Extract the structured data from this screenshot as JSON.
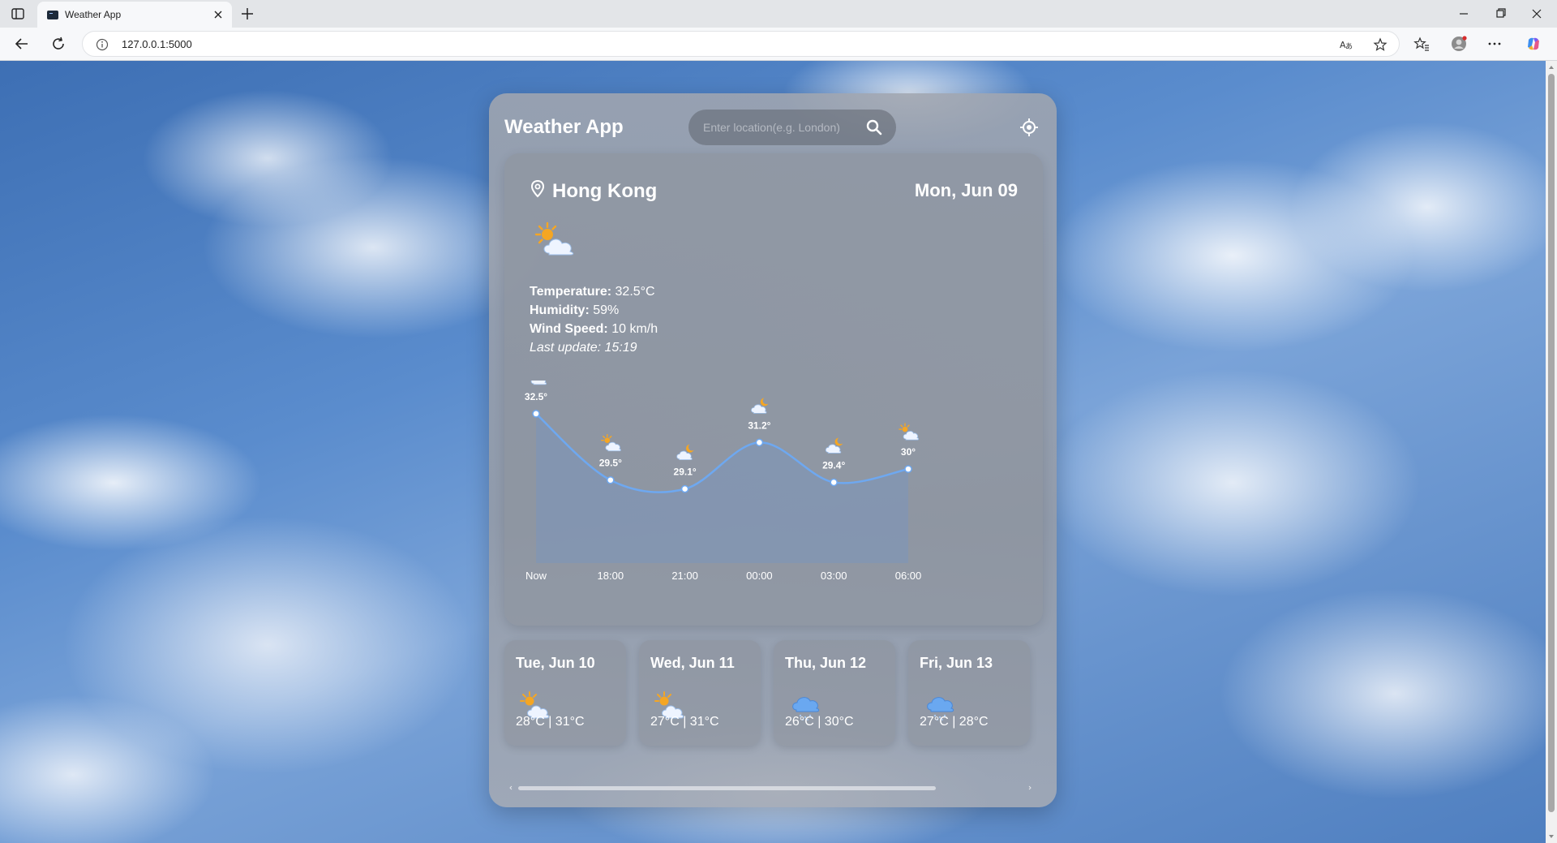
{
  "browser": {
    "tab_title": "Weather App",
    "url": "127.0.0.1:5000"
  },
  "app": {
    "title": "Weather App",
    "search_placeholder": "Enter location(e.g. London)",
    "location": "Hong Kong",
    "date": "Mon, Jun 09",
    "current_icon": "partly-cloudy-day-icon",
    "details": {
      "temperature_label": "Temperature:",
      "temperature_value": "32.5°C",
      "humidity_label": "Humidity:",
      "humidity_value": "59%",
      "wind_label": "Wind Speed:",
      "wind_value": "10 km/h",
      "last_update": "Last update: 15:19"
    },
    "forecast": [
      {
        "date": "Tue, Jun 10",
        "icon": "partly-cloudy-day-icon",
        "temps": "28°C | 31°C"
      },
      {
        "date": "Wed, Jun 11",
        "icon": "partly-cloudy-day-icon",
        "temps": "27°C | 31°C"
      },
      {
        "date": "Thu, Jun 12",
        "icon": "rain-cloud-icon",
        "temps": "26°C | 30°C"
      },
      {
        "date": "Fri, Jun 13",
        "icon": "rain-cloud-icon",
        "temps": "27°C | 28°C"
      }
    ]
  },
  "chart_data": {
    "type": "area",
    "categories": [
      "Now",
      "18:00",
      "21:00",
      "00:00",
      "03:00",
      "06:00"
    ],
    "values": [
      32.5,
      29.5,
      29.1,
      31.2,
      29.4,
      30
    ],
    "labels": [
      "32.5°",
      "29.5°",
      "29.1°",
      "31.2°",
      "29.4°",
      "30°"
    ],
    "icons": [
      "partly-cloudy-day-icon",
      "partly-cloudy-day-icon",
      "partly-cloudy-night-icon",
      "partly-cloudy-night-icon",
      "partly-cloudy-night-icon",
      "partly-cloudy-day-icon"
    ],
    "ylim": [
      23,
      34
    ],
    "grid": false,
    "line_color": "#6ea8f0"
  }
}
